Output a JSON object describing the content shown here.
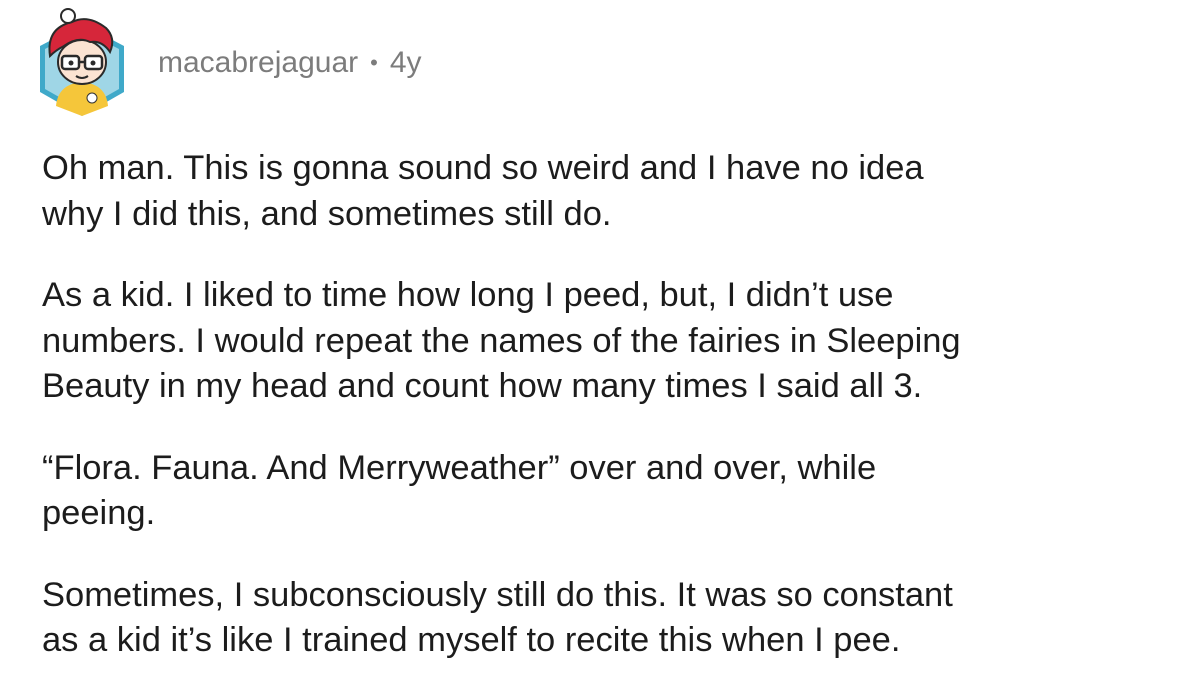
{
  "comment": {
    "author": "macabrejaguar",
    "separator": "•",
    "age": "4y",
    "avatar_icon": "snoo-avatar-red-hair-glasses-icon",
    "paragraphs": [
      "Oh man. This is gonna sound so weird and I have no idea\nwhy I did this, and sometimes still do.",
      "As a kid. I liked to time how long I peed, but, I didn’t use\nnumbers. I would repeat the names of the fairies in Sleeping\nBeauty in my head and count how many times I said all 3.",
      "“Flora. Fauna. And Merryweather” over and over, while\npeeing.",
      "Sometimes, I subconsciously still do this. It was so constant\nas a kid it’s like I trained myself to recite this when I pee."
    ]
  },
  "colors": {
    "meta_text": "#7c7c7c",
    "body_text": "#1c1c1c",
    "avatar_hex": "#3fa9c9",
    "avatar_hair": "#d6263a",
    "avatar_shirt": "#f5c63a"
  }
}
